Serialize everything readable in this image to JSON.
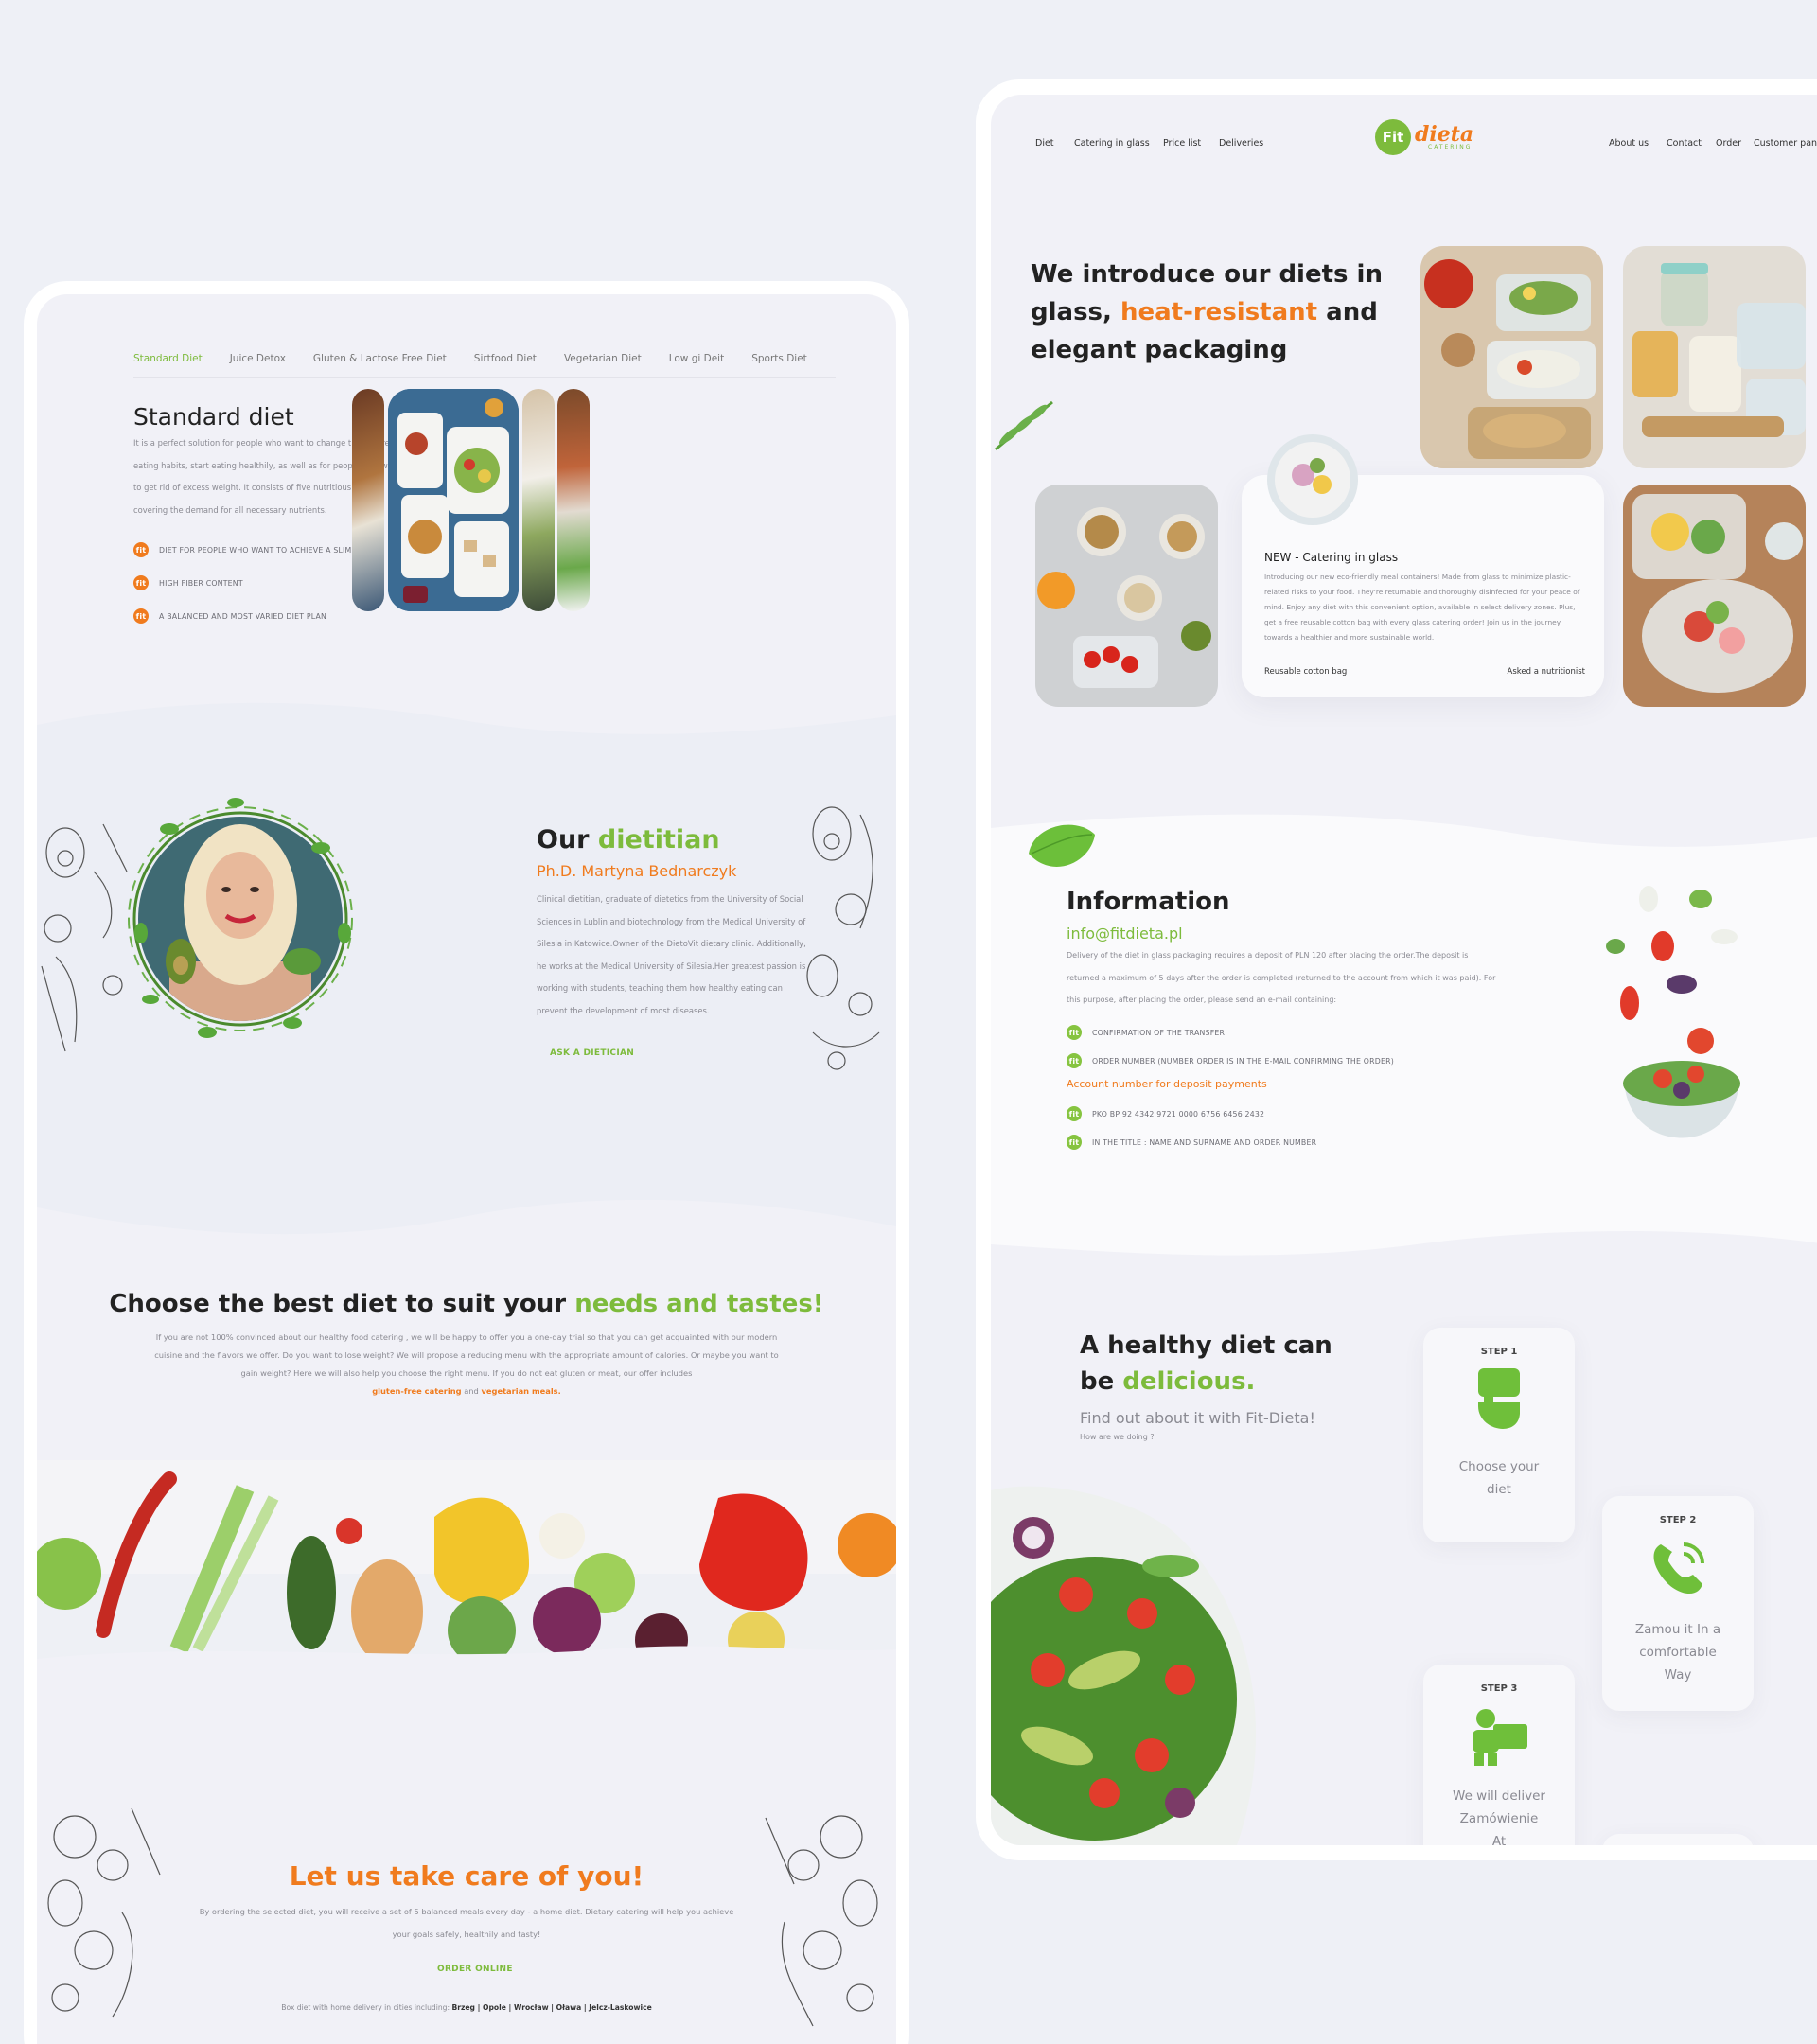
{
  "left": {
    "tabs": [
      "Standard Diet",
      "Juice Detox",
      "Gluten & Lactose Free Diet",
      "Sirtfood Diet",
      "Vegetarian Diet",
      "Low gi Deit",
      "Sports Diet"
    ],
    "standard": {
      "title": "Standard diet",
      "description": "It is a perfect solution for people who want to change their current eating habits, start eating healthily, as well as for people who want to get rid of excess weight. It consists of five nutritious meals, covering the demand for all necessary nutrients.",
      "bullets": [
        "DIET FOR PEOPLE WHO WANT TO ACHIEVE A SLIM FIGURE",
        "HIGH FIBER CONTENT",
        "A BALANCED AND MOST VARIED DIET PLAN"
      ]
    },
    "dietitian": {
      "title_a": "Our ",
      "title_b": "dietitian",
      "name": "Ph.D. Martyna Bednarczyk",
      "bio": "Clinical dietitian, graduate of dietetics from the University of Social Sciences in Lublin and biotechnology from the Medical University of Silesia in Katowice.Owner of the DietoVit dietary clinic. Additionally, he works at the Medical University of Silesia.Her greatest passion is working with students, teaching them how healthy eating can prevent the development of most diseases.",
      "button": "ASK A DIETICIAN"
    },
    "choose": {
      "title_a": "Choose the best diet to suit your ",
      "title_b": "needs and tastes!",
      "text": "If you are not 100% convinced about our healthy food catering , we will be happy to offer you a one-day trial so that you can get acquainted with our modern cuisine and the flavors we offer. Do you want to lose weight? We will propose a reducing menu with the appropriate amount of calories. Or maybe you want to gain weight? Here we will also help you choose the right menu. If you do not eat gluten or meat, our offer includes",
      "link1": "gluten-free catering",
      "and": " and ",
      "link2": "vegetarian meals."
    },
    "care": {
      "title": "Let us take care of you!",
      "text": "By ordering the selected diet, you will receive a set of 5 balanced meals every day - a home diet. Dietary catering will help you achieve your goals safely, healthily and tasty!",
      "button": "ORDER ONLINE",
      "cities_label": "Box diet with home delivery in cities including: ",
      "cities": "Brzeg | Opole | Wrocław | Oława | Jelcz-Laskowice"
    }
  },
  "right": {
    "nav_left": [
      "Diet",
      "Catering in glass",
      "Price list",
      "Deliveries"
    ],
    "nav_right": [
      "About us",
      "Contact",
      "Order",
      "Customer panel"
    ],
    "logo": {
      "word": "dieta",
      "fit": "Fit",
      "sub": "CATERING"
    },
    "intro": {
      "a": "We introduce our diets in glass, ",
      "b": "heat-resistant",
      "c": " and elegant packaging"
    },
    "news": {
      "title": "NEW - Catering in glass",
      "text": "Introducing our new eco-friendly meal containers! Made from glass to minimize plastic-related risks to your food. They're returnable and thoroughly disinfected for your peace of mind. Enjoy any diet with this convenient option, available in select delivery zones. Plus, get a free reusable cotton bag with every glass catering order! Join us in the journey towards a healthier and more sustainable world.",
      "left_link": "Reusable cotton bag",
      "right_link": "Asked a nutritionist"
    },
    "info": {
      "title": "Information",
      "email": "info@fitdieta.pl",
      "text": "Delivery of the diet in glass packaging requires a deposit of PLN 120 after placing the order.The deposit is returned a maximum of 5 days after the order is completed (returned to the account from which it was paid). For this purpose, after placing the order, please send an e-mail containing:",
      "items": [
        "CONFIRMATION OF THE TRANSFER",
        "ORDER NUMBER (NUMBER ORDER IS IN THE E-MAIL CONFIRMING THE ORDER)"
      ],
      "account_label": "Account number for deposit payments",
      "account_items": [
        "PKO BP 92 4342 9721 0000 6756 6456 2432",
        "IN THE TITLE : NAME AND SURNAME AND ORDER NUMBER"
      ]
    },
    "healthy": {
      "title_a": "A healthy diet can",
      "title_b": "be ",
      "title_c": "delicious.",
      "sub": "Find out about it with Fit-Dieta!",
      "small": "How are we doing ?"
    },
    "steps": [
      {
        "label": "STEP 1",
        "text": "Choose your diet"
      },
      {
        "label": "STEP 2",
        "text": "Zamou it In a comfortable Way"
      },
      {
        "label": "STEP 3",
        "text": "We will deliver Zamówienie At"
      }
    ]
  },
  "colors": {
    "green": "#7dbb3c",
    "orange": "#f07b1e",
    "background": "#eef0f6"
  }
}
